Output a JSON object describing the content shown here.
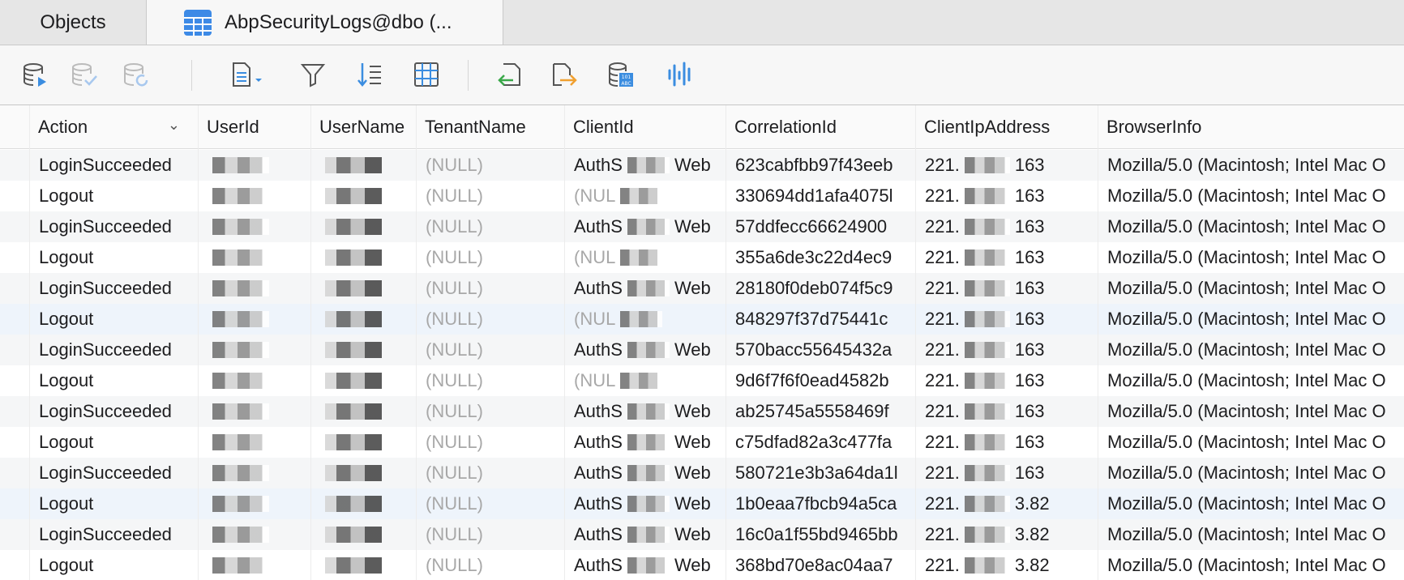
{
  "tabs": [
    {
      "label": "Objects"
    },
    {
      "label": "AbpSecurityLogs@dbo (..."
    }
  ],
  "toolbar": {
    "buttons": [
      {
        "icon": "db-run-icon"
      },
      {
        "icon": "db-commit-icon"
      },
      {
        "icon": "db-refresh-icon"
      },
      {
        "icon": "document-menu-icon"
      },
      {
        "icon": "filter-icon"
      },
      {
        "icon": "sort-icon"
      },
      {
        "icon": "grid-icon"
      },
      {
        "icon": "import-icon"
      },
      {
        "icon": "export-icon"
      },
      {
        "icon": "db-data-icon"
      },
      {
        "icon": "chart-icon"
      }
    ]
  },
  "columns": [
    {
      "label": "Action"
    },
    {
      "label": "UserId"
    },
    {
      "label": "UserName"
    },
    {
      "label": "TenantName"
    },
    {
      "label": "ClientId"
    },
    {
      "label": "CorrelationId"
    },
    {
      "label": "ClientIpAddress"
    },
    {
      "label": "BrowserInfo"
    }
  ],
  "rows": [
    {
      "action": "LoginSucceeded",
      "tenant": "(NULL)",
      "client": "AuthS",
      "client_suffix": "Web",
      "corr": "623cabfbb97f43eeb",
      "ip": "221.",
      "ip_suffix": "163",
      "browser": "Mozilla/5.0 (Macintosh; Intel Mac O"
    },
    {
      "action": "Logout",
      "tenant": "(NULL)",
      "client": "(NUL",
      "client_suffix": "",
      "corr": "330694dd1afa4075l",
      "ip": "221.",
      "ip_suffix": "163",
      "browser": "Mozilla/5.0 (Macintosh; Intel Mac O"
    },
    {
      "action": "LoginSucceeded",
      "tenant": "(NULL)",
      "client": "AuthS",
      "client_suffix": "Web",
      "corr": "57ddfecc66624900",
      "ip": "221.",
      "ip_suffix": "163",
      "browser": "Mozilla/5.0 (Macintosh; Intel Mac O"
    },
    {
      "action": "Logout",
      "tenant": "(NULL)",
      "client": "(NUL",
      "client_suffix": "",
      "corr": "355a6de3c22d4ec9",
      "ip": "221.",
      "ip_suffix": "163",
      "browser": "Mozilla/5.0 (Macintosh; Intel Mac O"
    },
    {
      "action": "LoginSucceeded",
      "tenant": "(NULL)",
      "client": "AuthS",
      "client_suffix": "Web",
      "corr": "28180f0deb074f5c9",
      "ip": "221.",
      "ip_suffix": "163",
      "browser": "Mozilla/5.0 (Macintosh; Intel Mac O"
    },
    {
      "action": "Logout",
      "tenant": "(NULL)",
      "client": "(NUL",
      "client_suffix": "",
      "corr": "848297f37d75441c",
      "ip": "221.",
      "ip_suffix": "163",
      "browser": "Mozilla/5.0 (Macintosh; Intel Mac O"
    },
    {
      "action": "LoginSucceeded",
      "tenant": "(NULL)",
      "client": "AuthS",
      "client_suffix": "Web",
      "corr": "570bacc55645432a",
      "ip": "221.",
      "ip_suffix": "163",
      "browser": "Mozilla/5.0 (Macintosh; Intel Mac O"
    },
    {
      "action": "Logout",
      "tenant": "(NULL)",
      "client": "(NUL",
      "client_suffix": "",
      "corr": "9d6f7f6f0ead4582b",
      "ip": "221.",
      "ip_suffix": "163",
      "browser": "Mozilla/5.0 (Macintosh; Intel Mac O"
    },
    {
      "action": "LoginSucceeded",
      "tenant": "(NULL)",
      "client": "AuthS",
      "client_suffix": "Web",
      "corr": "ab25745a5558469f",
      "ip": "221.",
      "ip_suffix": "163",
      "browser": "Mozilla/5.0 (Macintosh; Intel Mac O"
    },
    {
      "action": "Logout",
      "tenant": "(NULL)",
      "client": "AuthS",
      "client_suffix": "Web",
      "corr": "c75dfad82a3c477fa",
      "ip": "221.",
      "ip_suffix": "163",
      "browser": "Mozilla/5.0 (Macintosh; Intel Mac O"
    },
    {
      "action": "LoginSucceeded",
      "tenant": "(NULL)",
      "client": "AuthS",
      "client_suffix": "Web",
      "corr": "580721e3b3a64da1l",
      "ip": "221.",
      "ip_suffix": "163",
      "browser": "Mozilla/5.0 (Macintosh; Intel Mac O"
    },
    {
      "action": "Logout",
      "tenant": "(NULL)",
      "client": "AuthS",
      "client_suffix": "Web",
      "corr": "1b0eaa7fbcb94a5ca",
      "ip": "221.",
      "ip_suffix": "3.82",
      "browser": "Mozilla/5.0 (Macintosh; Intel Mac O"
    },
    {
      "action": "LoginSucceeded",
      "tenant": "(NULL)",
      "client": "AuthS",
      "client_suffix": "Web",
      "corr": "16c0a1f55bd9465bb",
      "ip": "221.",
      "ip_suffix": "3.82",
      "browser": "Mozilla/5.0 (Macintosh; Intel Mac O"
    },
    {
      "action": "Logout",
      "tenant": "(NULL)",
      "client": "AuthS",
      "client_suffix": "Web",
      "corr": "368bd70e8ac04aa7",
      "ip": "221.",
      "ip_suffix": "3.82",
      "browser": "Mozilla/5.0 (Macintosh; Intel Mac O"
    }
  ]
}
